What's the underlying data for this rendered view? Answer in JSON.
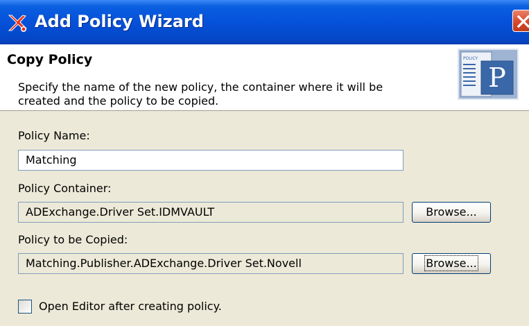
{
  "window": {
    "title": "Add Policy Wizard",
    "close_label": "Close"
  },
  "banner": {
    "title": "Copy Policy",
    "description": "Specify the name of the new policy, the container where it will be created and the policy to be copied.",
    "icon": "policy-document-icon",
    "icon_caption": "POLICY",
    "icon_letter": "P"
  },
  "form": {
    "policy_name": {
      "label": "Policy Name:",
      "value": "Matching"
    },
    "policy_container": {
      "label": "Policy Container:",
      "value": "ADExchange.Driver Set.IDMVAULT",
      "browse_label": "Browse..."
    },
    "policy_to_copy": {
      "label": "Policy to be Copied:",
      "value": "Matching.Publisher.ADExchange.Driver Set.Novell",
      "browse_label": "Browse..."
    },
    "open_editor": {
      "label": "Open Editor after creating policy.",
      "checked": false
    }
  },
  "colors": {
    "titlebar": "#0551d9",
    "dialog_bg": "#ece9d8",
    "close_button": "#d8492b",
    "banner_icon_accent": "#3a67a8"
  }
}
